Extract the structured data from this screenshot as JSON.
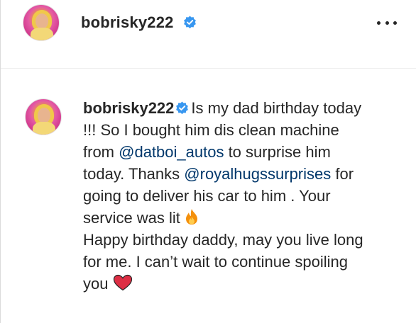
{
  "post": {
    "username": "bobrisky222",
    "verified_badge_icon": "verified-badge-icon",
    "more_icon": "more-horizontal-icon"
  },
  "caption": {
    "username": "bobrisky222",
    "text1": "Is my dad birthday today !!! So I bought him dis clean machine from ",
    "mention1": "@datboi_autos",
    "text2": " to surprise him today. Thanks ",
    "mention2": "@royalhugssurprises",
    "text3": " for going to deliver his car to him . Your service was lit ",
    "emoji1": "fire-emoji",
    "text4": "Happy birthday daddy, may you live long for me. I can’t wait to continue spoiling you ",
    "emoji2": "red-heart-emoji"
  },
  "colors": {
    "text": "#262626",
    "mention": "#00376b",
    "verified": "#3897f0",
    "divider": "#efefef"
  }
}
